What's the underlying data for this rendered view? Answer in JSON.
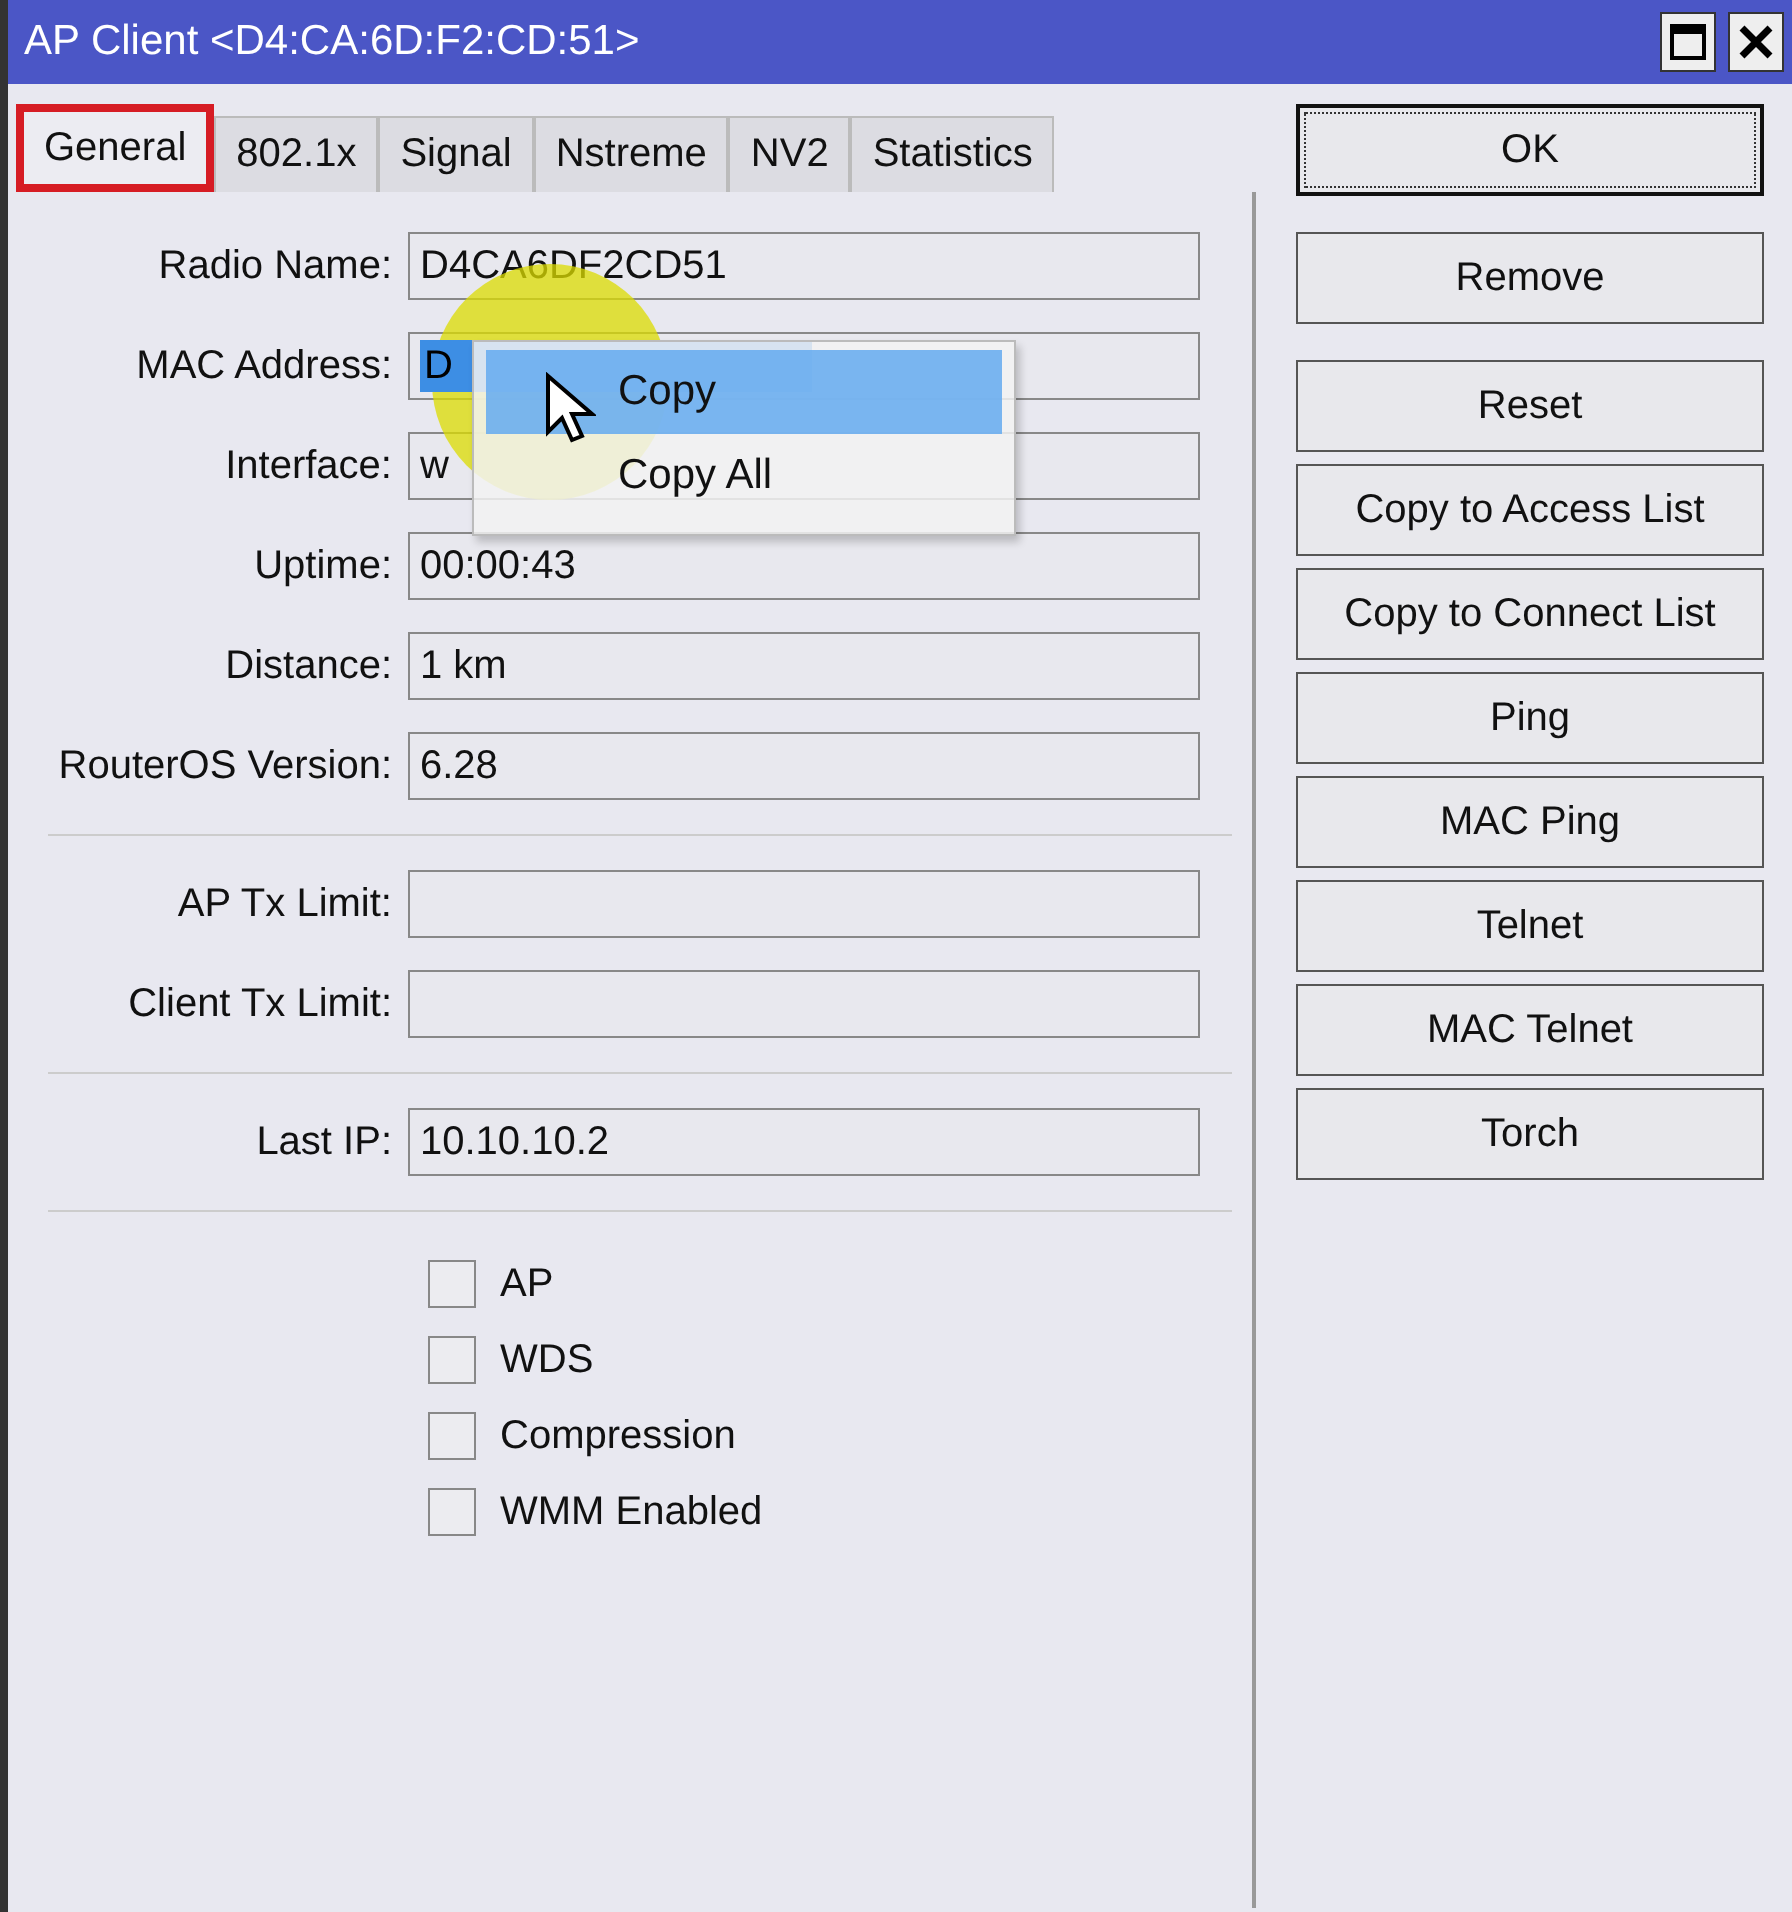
{
  "window": {
    "title": "AP Client <D4:CA:6D:F2:CD:51>"
  },
  "tabs": [
    {
      "label": "General",
      "selected": true
    },
    {
      "label": "802.1x",
      "selected": false
    },
    {
      "label": "Signal",
      "selected": false
    },
    {
      "label": "Nstreme",
      "selected": false
    },
    {
      "label": "NV2",
      "selected": false
    },
    {
      "label": "Statistics",
      "selected": false
    }
  ],
  "groups": [
    {
      "rows": [
        {
          "kind": "field",
          "label": "Radio Name:",
          "value": "D4CA6DF2CD51"
        },
        {
          "kind": "field",
          "label": "MAC Address:",
          "value": "D",
          "text_selected": true
        },
        {
          "kind": "field",
          "label": "Interface:",
          "value": "w"
        },
        {
          "kind": "field",
          "label": "Uptime:",
          "value": "00:00:43"
        },
        {
          "kind": "field",
          "label": "Distance:",
          "value": "1 km"
        },
        {
          "kind": "field",
          "label": "RouterOS Version:",
          "value": "6.28"
        }
      ]
    },
    {
      "rows": [
        {
          "kind": "field",
          "label": "AP Tx Limit:"
        },
        {
          "kind": "field",
          "label": "Client Tx Limit:"
        }
      ]
    },
    {
      "rows": [
        {
          "kind": "field",
          "label": "Last IP:",
          "value": "10.10.10.2"
        }
      ]
    },
    {
      "rows": [
        {
          "kind": "checkbox",
          "label": "AP",
          "checked": false
        },
        {
          "kind": "checkbox",
          "label": "WDS",
          "checked": false
        },
        {
          "kind": "checkbox",
          "label": "Compression",
          "checked": false
        },
        {
          "kind": "checkbox",
          "label": "WMM Enabled",
          "checked": false
        }
      ]
    }
  ],
  "buttons": [
    {
      "label": "OK",
      "default": true
    },
    {
      "label": "Remove",
      "default": false
    },
    {
      "label": "Reset",
      "default": false
    },
    {
      "label": "Copy to Access List",
      "default": false
    },
    {
      "label": "Copy to Connect List",
      "default": false
    },
    {
      "label": "Ping",
      "default": false
    },
    {
      "label": "MAC Ping",
      "default": false
    },
    {
      "label": "Telnet",
      "default": false
    },
    {
      "label": "MAC Telnet",
      "default": false
    },
    {
      "label": "Torch",
      "default": false
    }
  ],
  "context_menu": {
    "items": [
      {
        "label": "Copy",
        "selected": true
      },
      {
        "label": "Copy All",
        "selected": false
      }
    ]
  }
}
